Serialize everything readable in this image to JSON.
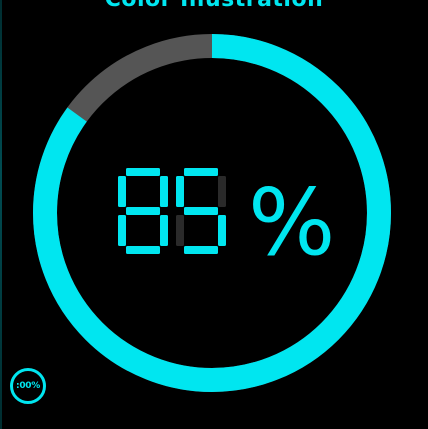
{
  "header": {
    "title": "Color Illustration"
  },
  "gauge": {
    "percent": 85,
    "digit_1": "8",
    "digit_2": "5",
    "percent_sign": "%",
    "accent_color": "#00e6f0",
    "track_color": "#555555",
    "background_color": "#000000"
  },
  "mini_badge": {
    "label": ":00%"
  }
}
